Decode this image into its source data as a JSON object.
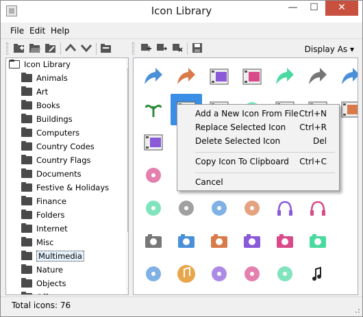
{
  "window": {
    "title": "Icon Library"
  },
  "menubar": {
    "items": [
      "File",
      "Edit",
      "Help"
    ]
  },
  "toolbar": {
    "display_as": "Display As ▾"
  },
  "tree": {
    "root": "Icon Library",
    "items": [
      "Animals",
      "Art",
      "Books",
      "Buildings",
      "Computers",
      "Country Codes",
      "Country Flags",
      "Documents",
      "Festive & Holidays",
      "Finance",
      "Folders",
      "Internet",
      "Misc",
      "Multimedia",
      "Nature",
      "Objects",
      "Off"
    ],
    "selected": "Multimedia"
  },
  "context_menu": {
    "items": [
      {
        "label": "Add a New Icon From File",
        "shortcut": "Ctrl+N"
      },
      {
        "label": "Replace Selected Icon",
        "shortcut": "Ctrl+R"
      },
      {
        "label": "Delete Selected Icon",
        "shortcut": "Del"
      },
      {
        "label": "Copy Icon To Clipboard",
        "shortcut": "Ctrl+C"
      },
      {
        "label": "Cancel",
        "shortcut": ""
      }
    ]
  },
  "status": {
    "text": "Total icons: 76"
  },
  "colors": {
    "selection": "#3a8ee6",
    "close_button": "#c7503e"
  }
}
